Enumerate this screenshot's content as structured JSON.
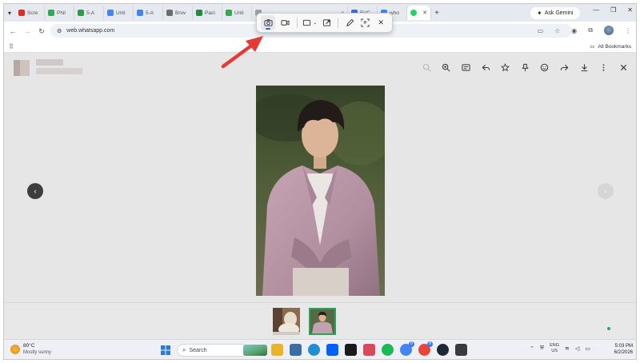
{
  "browser": {
    "tabs": [
      {
        "label": "Scre",
        "color": "#d93025",
        "glyph": "M"
      },
      {
        "label": "Phil",
        "color": "#34a853",
        "glyph": ""
      },
      {
        "label": "5-A",
        "color": "#2a9d4b",
        "glyph": ""
      },
      {
        "label": "Unti",
        "color": "#4285f4",
        "glyph": ""
      },
      {
        "label": "5-A",
        "color": "#4285f4",
        "glyph": ""
      },
      {
        "label": "Brov",
        "color": "#6d6d6d",
        "glyph": ""
      },
      {
        "label": "Paci",
        "color": "#1e8e3e",
        "glyph": ""
      },
      {
        "label": "Unti",
        "color": "#34a853",
        "glyph": ""
      },
      {
        "label": "x",
        "color": "#9aa0a6",
        "glyph": ""
      },
      {
        "label": "FVC",
        "color": "#3b6fd8",
        "glyph": ""
      },
      {
        "label": "who",
        "color": "#4285f4",
        "glyph": "G"
      }
    ],
    "active_tab_color": "#25d366",
    "ask_gemini_label": "Ask Gemini",
    "address": "web.whatsapp.com",
    "all_bookmarks_label": "All Bookmarks"
  },
  "snipping_tool": {
    "modes": [
      "camera-icon",
      "video-icon",
      "rectangle-icon",
      "window-icon",
      "pen-icon",
      "text-recognition-icon",
      "close-icon"
    ],
    "active_mode": "camera-icon",
    "accent": "#2a62d6"
  },
  "annotation": {
    "arrow_color": "#e53935"
  },
  "viewer": {
    "actions": [
      "search-icon",
      "zoom-in-icon",
      "caption-icon",
      "reply-icon",
      "star-icon",
      "pin-icon",
      "emoji-icon",
      "forward-icon",
      "download-icon",
      "more-icon",
      "close-icon"
    ],
    "thumbnail_count": 2,
    "selected_thumbnail_color": "#1fa855"
  },
  "taskbar": {
    "weather_temp": "80°C",
    "weather_desc": "Mostly sunny",
    "search_label": "Search",
    "lang_line1": "ENG",
    "lang_line2": "US",
    "time": "5:03 PM",
    "date": "6/2/2026",
    "apps": [
      {
        "name": "file-explorer-icon",
        "color": "#e9b429"
      },
      {
        "name": "notepad-icon",
        "color": "#3a6ea5"
      },
      {
        "name": "edge-icon",
        "color": "#1f8fd6"
      },
      {
        "name": "dropbox-icon",
        "color": "#0061fe"
      },
      {
        "name": "stocks-icon",
        "color": "#1b1b1b"
      },
      {
        "name": "paint-icon",
        "color": "#d9485b"
      },
      {
        "name": "spotify-icon",
        "color": "#1db954"
      },
      {
        "name": "chrome-icon",
        "color": "#4285f4",
        "badge": "8"
      },
      {
        "name": "chrome-profile-icon",
        "color": "#e8453c",
        "badge": "8"
      },
      {
        "name": "steam-icon",
        "color": "#1b2838"
      },
      {
        "name": "app-icon",
        "color": "#3b3b3b"
      }
    ]
  }
}
